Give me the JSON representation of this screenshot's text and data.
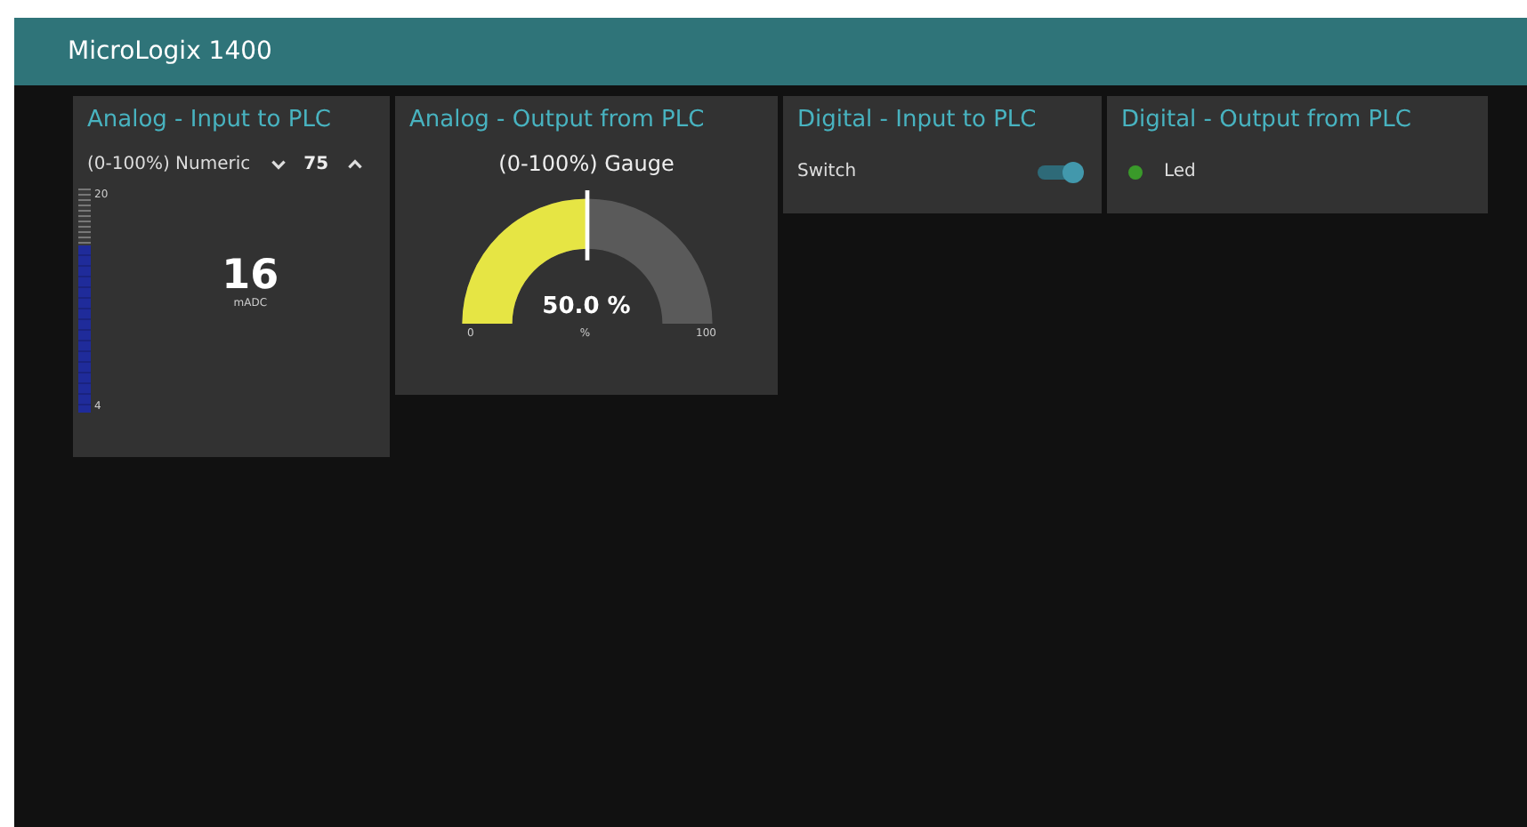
{
  "header": {
    "title": "MicroLogix 1400"
  },
  "cards": [
    {
      "kind": "analog-input",
      "title": "Analog - Input to PLC",
      "numeric": {
        "label": "(0-100%) Numeric",
        "value": "75"
      },
      "bar": {
        "max_label": "20",
        "min_label": "4",
        "level": 0.75
      },
      "reading": {
        "value": "16",
        "unit": "mADC"
      }
    },
    {
      "kind": "gauge",
      "title": "Analog - Output from PLC",
      "gauge": {
        "label": "(0-100%) Gauge",
        "value": "50.0 %",
        "unit": "%",
        "min_label": "0",
        "max_label": "100"
      }
    },
    {
      "kind": "switch",
      "title": "Digital - Input to PLC",
      "switch": {
        "label": "Switch",
        "on": true
      }
    },
    {
      "kind": "led",
      "title": "Digital - Output from PLC",
      "led": {
        "label": "Led",
        "color": "#3a9a2a"
      }
    }
  ]
}
